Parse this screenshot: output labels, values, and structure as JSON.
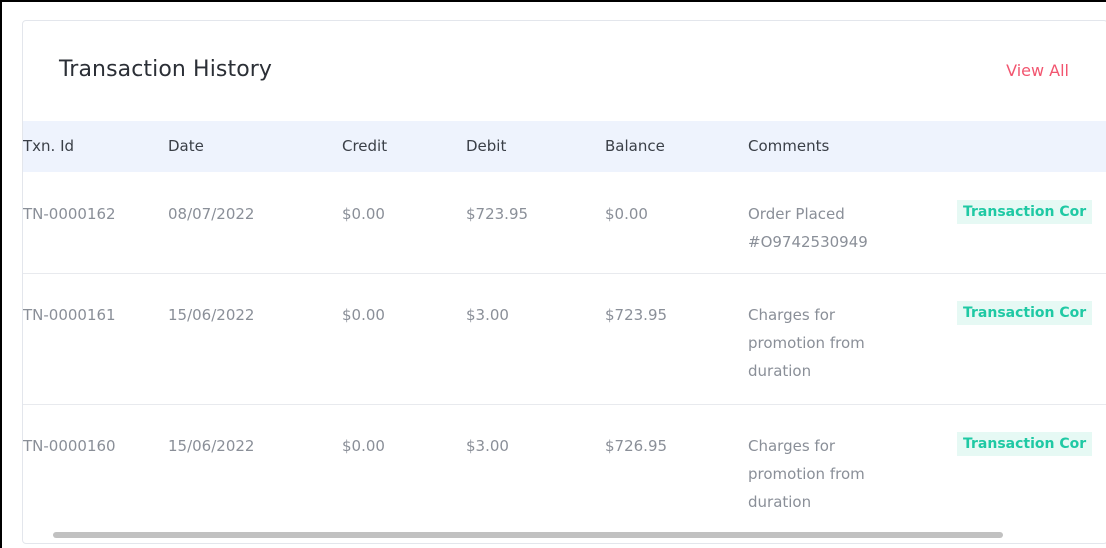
{
  "card": {
    "title": "Transaction History",
    "view_all_label": "View All"
  },
  "table": {
    "headers": {
      "txn_id": "Txn. Id",
      "date": "Date",
      "credit": "Credit",
      "debit": "Debit",
      "balance": "Balance",
      "comments": "Comments"
    },
    "rows": [
      {
        "txn_id": "TN-0000162",
        "date": "08/07/2022",
        "credit": "$0.00",
        "debit": "$723.95",
        "balance": "$0.00",
        "comments": "Order Placed #O9742530949",
        "status": "Transaction Cor"
      },
      {
        "txn_id": "TN-0000161",
        "date": "15/06/2022",
        "credit": "$0.00",
        "debit": "$3.00",
        "balance": "$723.95",
        "comments": "Charges for promotion from duration",
        "status": "Transaction Cor"
      },
      {
        "txn_id": "TN-0000160",
        "date": "15/06/2022",
        "credit": "$0.00",
        "debit": "$3.00",
        "balance": "$726.95",
        "comments": "Charges for promotion from duration",
        "status": "Transaction Cor"
      }
    ]
  },
  "colors": {
    "accent_link": "#f2556f",
    "status_text": "#1fc9a4",
    "status_bg": "#e6f9f4",
    "header_bg": "#eef3fd"
  }
}
